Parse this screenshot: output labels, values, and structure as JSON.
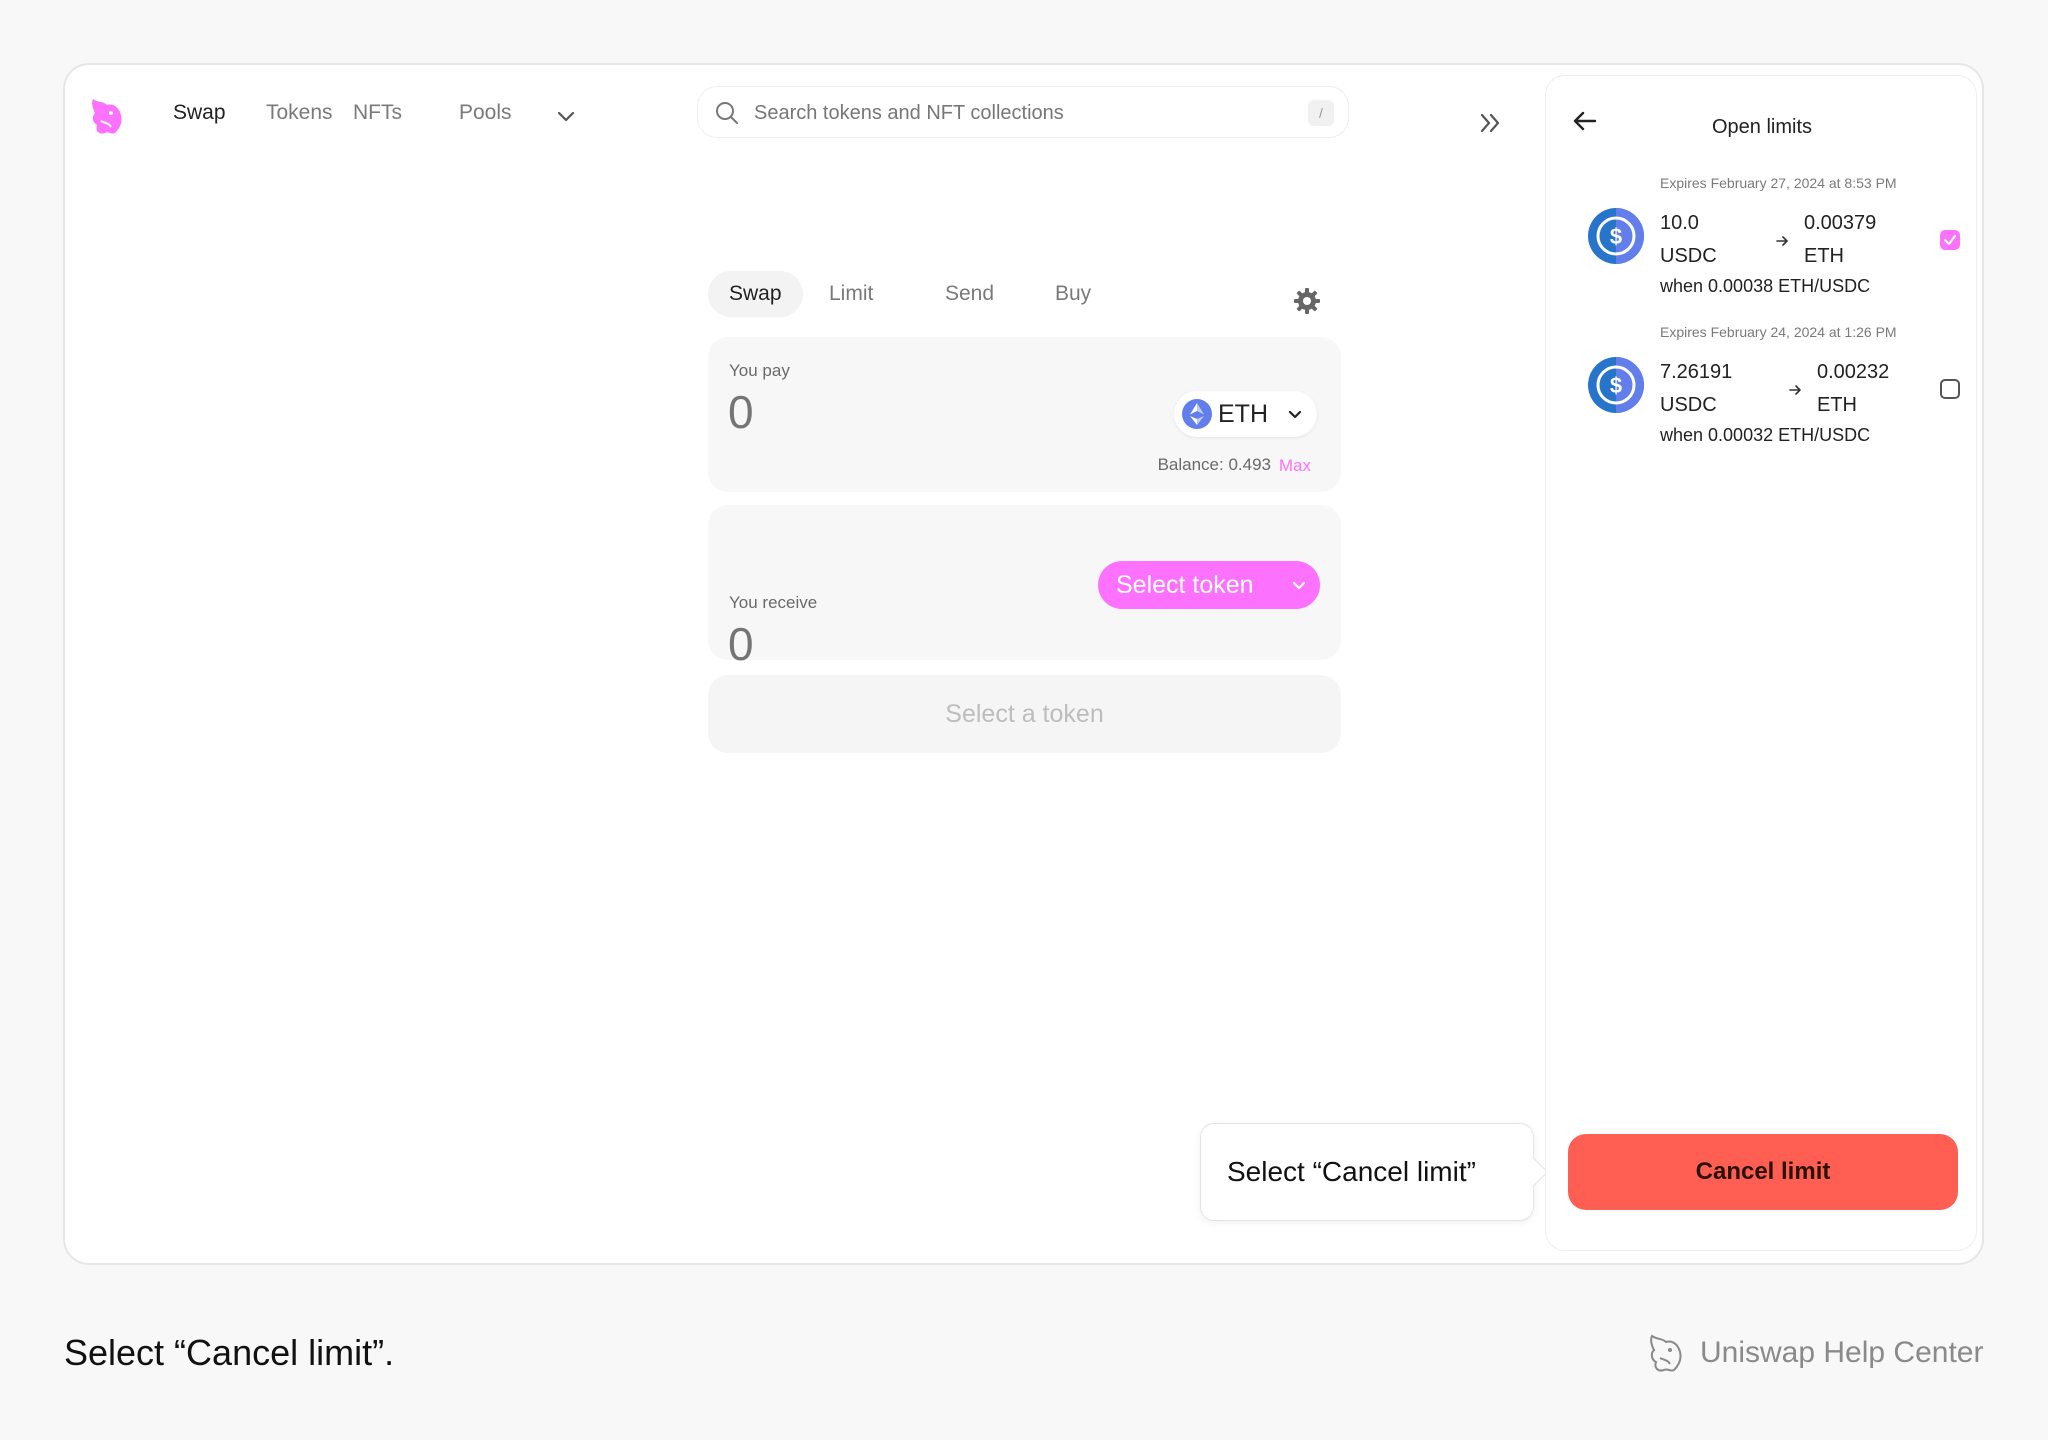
{
  "nav": {
    "links": [
      "Swap",
      "Tokens",
      "NFTs",
      "Pools"
    ],
    "search_placeholder": "Search tokens and NFT collections",
    "search_shortcut": "/"
  },
  "swap": {
    "tabs": [
      "Swap",
      "Limit",
      "Send",
      "Buy"
    ],
    "pay": {
      "label": "You pay",
      "amount": "0",
      "token": "ETH",
      "balance": "Balance: 0.493",
      "max_label": "Max"
    },
    "receive": {
      "label": "You receive",
      "amount": "0",
      "select_label": "Select token"
    },
    "cta_label": "Select a token"
  },
  "panel": {
    "title": "Open limits",
    "orders": [
      {
        "expires": "Expires February 27, 2024 at 8:53 PM",
        "in_amount": "10.0",
        "in_symbol": "USDC",
        "out_amount": "0.00379",
        "out_symbol": "ETH",
        "when": "when 0.00038 ETH/USDC",
        "selected": true
      },
      {
        "expires": "Expires February 24, 2024 at 1:26 PM",
        "in_amount": "7.26191",
        "in_symbol": "USDC",
        "out_amount": "0.00232",
        "out_symbol": "ETH",
        "when": "when 0.00032 ETH/USDC",
        "selected": false
      }
    ],
    "cancel_label": "Cancel limit"
  },
  "callout": "Select “Cancel limit”",
  "caption": "Select “Cancel limit”.",
  "brand": "Uniswap Help Center",
  "colors": {
    "accent_pink": "#fc72ff",
    "cancel_red": "#ff5f52",
    "eth_blue": "#627eea",
    "usdc_blue": "#2775ca"
  }
}
